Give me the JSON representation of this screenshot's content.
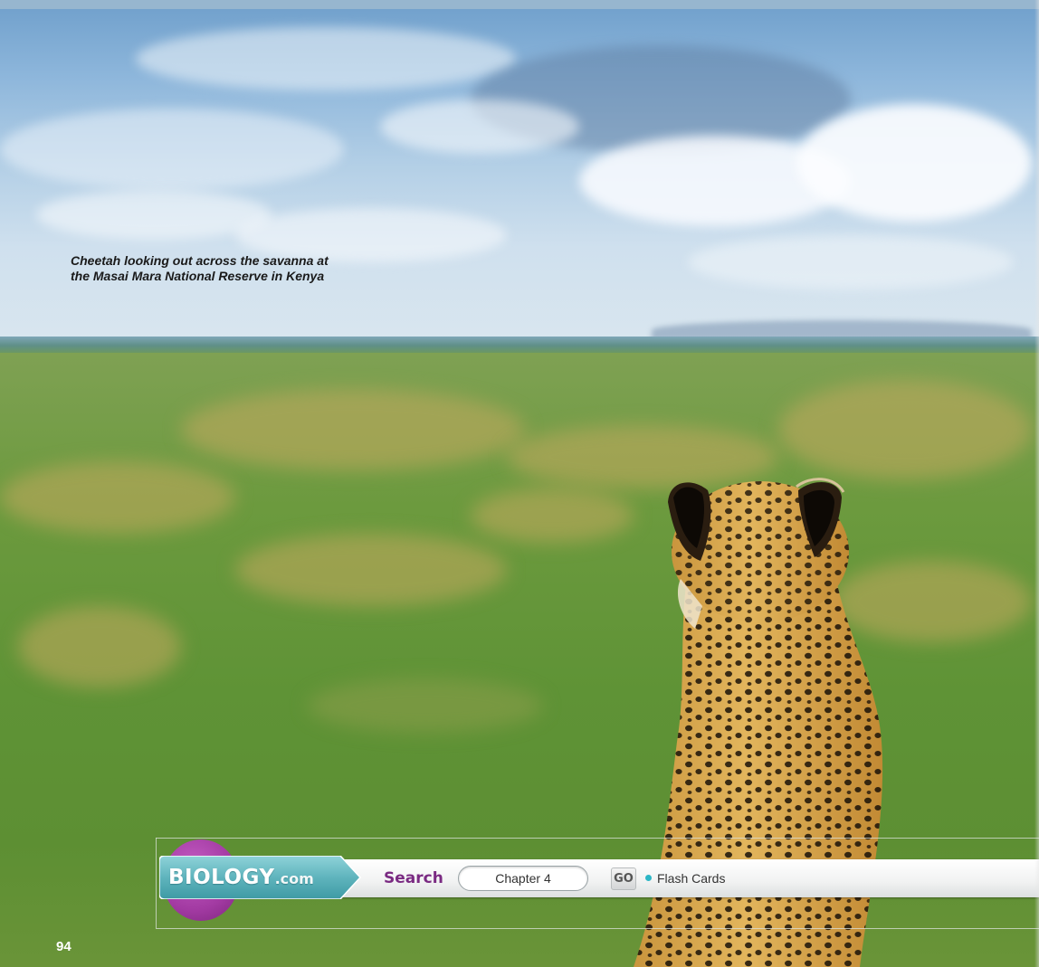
{
  "photo": {
    "caption_line1": "Cheetah looking out across the savanna at",
    "caption_line2": "the Masai Mara National Reserve in Kenya"
  },
  "toolbar": {
    "logo_main": "BIOLOGY",
    "logo_suffix": ".com",
    "search_label": "Search",
    "search_value": "Chapter 4",
    "go_label": "GO",
    "link_label": "Flash Cards",
    "colors": {
      "logo_plate": "#5fb4bd",
      "logo_circle": "#a23aa2",
      "search_label": "#7a2a82",
      "bullet": "#2cb6c6"
    }
  },
  "page": {
    "number": "94"
  }
}
